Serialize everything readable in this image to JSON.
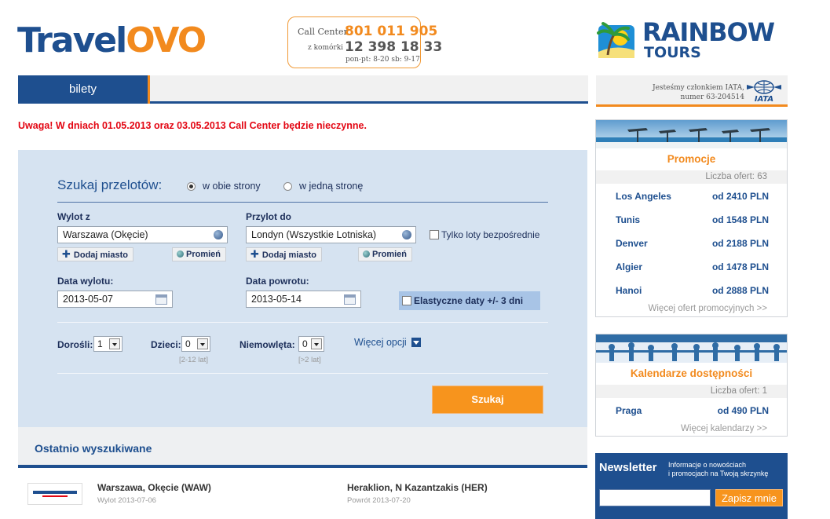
{
  "brand": {
    "travel": "Travel",
    "ovo": "OVO"
  },
  "call_center": {
    "label": "Call Center",
    "number": "801 011 905",
    "mobile_label": "z komórki",
    "mobile_number": "12 398 18 33",
    "hours": "pon-pt: 8-20  sb: 9-17"
  },
  "partner": {
    "name": "RAINBOW",
    "sub": "TOURS"
  },
  "iata": {
    "text1": "Jesteśmy członkiem IATA,",
    "text2": "numer 63-204514",
    "logo": "IATA"
  },
  "tabs": [
    {
      "label": "bilety",
      "active": true
    }
  ],
  "alert": "Uwaga! W dniach 01.05.2013 oraz 03.05.2013 Call Center będzie nieczynne.",
  "search": {
    "title": "Szukaj przelotów:",
    "trip_types": [
      {
        "label": "w obie strony",
        "checked": true
      },
      {
        "label": "w jedną stronę",
        "checked": false
      }
    ],
    "from_label": "Wylot z",
    "from_value": "Warszawa (Okęcie)",
    "to_label": "Przylot do",
    "to_value": "Londyn (Wszystkie Lotniska)",
    "direct_only": "Tylko loty bezpośrednie",
    "add_city": "Dodaj miasto",
    "radius": "Promień",
    "depart_label": "Data wylotu:",
    "depart_value": "2013-05-07",
    "return_label": "Data powrotu:",
    "return_value": "2013-05-14",
    "flexible": "Elastyczne daty +/- 3 dni",
    "adults_label": "Dorośli:",
    "adults_value": "1",
    "children_label": "Dzieci:",
    "children_value": "0",
    "children_hint": "[2-12 lat]",
    "infants_label": "Niemowlęta:",
    "infants_value": "0",
    "infants_hint": "[>2 lat]",
    "more_options": "Więcej opcji",
    "submit": "Szukaj"
  },
  "recent": {
    "title": "Ostatnio wyszukiwane",
    "items": [
      {
        "airline": "AEGEAN AIRLINES",
        "from": "Warszawa, Okęcie (WAW)",
        "depart": "Wylot 2013-07-06",
        "to": "Heraklion, N Kazantzakis (HER)",
        "return": "Powrót 2013-07-20"
      }
    ]
  },
  "promotions": {
    "title": "Promocje",
    "count": "Liczba ofert: 63",
    "items": [
      {
        "city": "Los Angeles",
        "price": "od 2410 PLN"
      },
      {
        "city": "Tunis",
        "price": "od 1548 PLN"
      },
      {
        "city": "Denver",
        "price": "od 2188 PLN"
      },
      {
        "city": "Algier",
        "price": "od 1478 PLN"
      },
      {
        "city": "Hanoi",
        "price": "od 2888 PLN"
      }
    ],
    "more": "Więcej ofert promocyjnych >>"
  },
  "calendars": {
    "title": "Kalendarze dostępności",
    "count": "Liczba ofert: 1",
    "items": [
      {
        "city": "Praga",
        "price_prefix": "od",
        "price": "490 PLN"
      }
    ],
    "more": "Więcej kalendarzy >>"
  },
  "newsletter": {
    "title": "Newsletter",
    "text1": "Informacje o nowościach",
    "text2": "i promocjach na Twoją skrzynkę",
    "button": "Zapisz mnie"
  },
  "colors": {
    "primary": "#1e4f8f",
    "accent": "#f28a1e",
    "alert": "#e30613",
    "panel_bg": "#d6e3f1"
  }
}
